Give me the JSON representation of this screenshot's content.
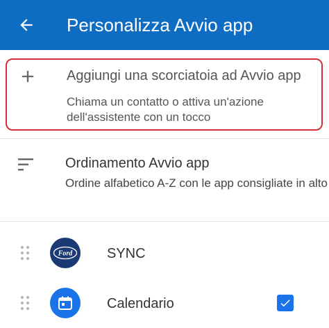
{
  "header": {
    "title": "Personalizza Avvio app",
    "background_color": "#0F6CC3",
    "back_icon": "arrow-back-icon"
  },
  "add_shortcut": {
    "icon": "plus-icon",
    "title": "Aggiungi una scorciatoia ad Avvio app",
    "subtitle": "Chiama un contatto o attiva un'azione dell'assistente con un tocco",
    "highlight_color": "#d32f3a"
  },
  "sorting": {
    "icon": "sort-icon",
    "title": "Ordinamento Avvio app",
    "subtitle": "Ordine alfabetico A-Z con le app consigliate in alto"
  },
  "apps": [
    {
      "label": "SYNC",
      "icon": "ford-logo-icon",
      "icon_color": "#1b3a73",
      "icon_text": "Ford"
    },
    {
      "label": "Calendario",
      "icon": "calendar-icon",
      "icon_color": "#1a73e8",
      "checked": true
    }
  ]
}
